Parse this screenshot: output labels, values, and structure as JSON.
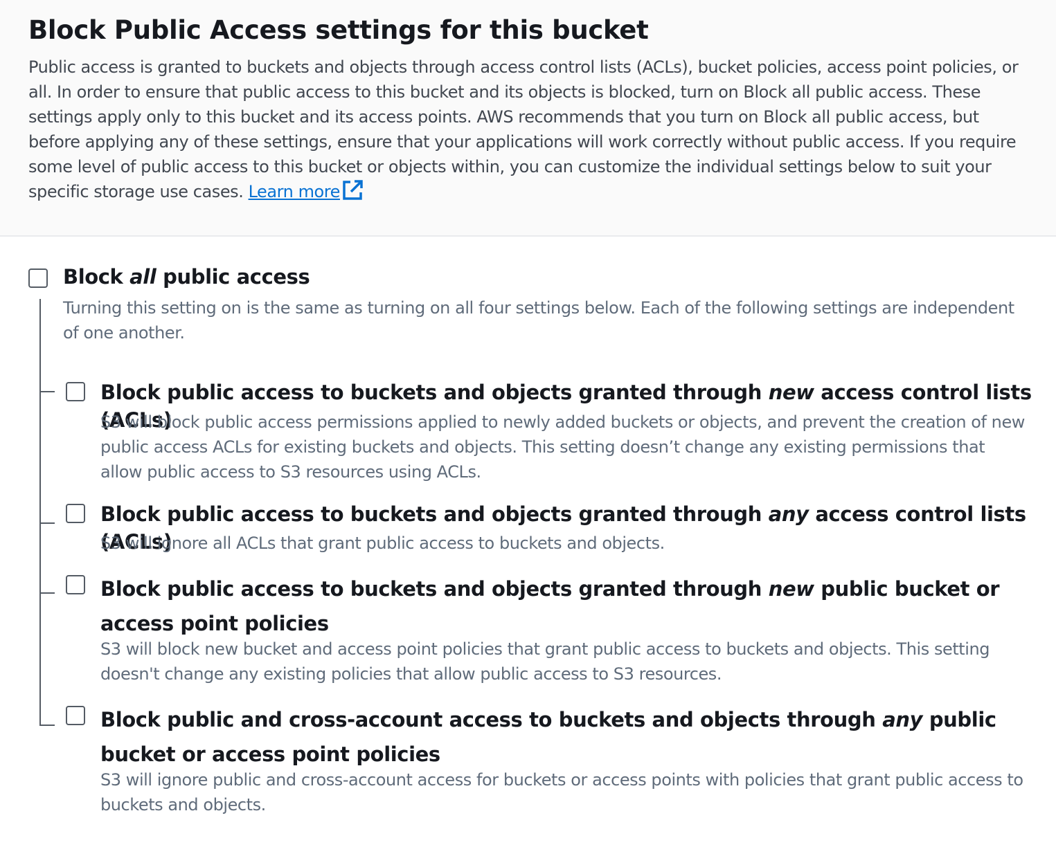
{
  "header": {
    "title": "Block Public Access settings for this bucket",
    "description": "Public access is granted to buckets and objects through access control lists (ACLs), bucket policies, access point policies, or all. In order to ensure that public access to this bucket and its objects is blocked, turn on Block all public access. These settings apply only to this bucket and its access points. AWS recommends that you turn on Block all public access, but before applying any of these settings, ensure that your applications will work correctly without public access. If you require some level of public access to this bucket or objects within, you can customize the individual settings below to suit your specific storage use cases.",
    "learn_more": "Learn more",
    "learn_more_icon": "external-link-icon",
    "link_color": "#0972d3"
  },
  "block_all": {
    "label_before": "Block ",
    "label_em": "all",
    "label_after": " public access",
    "description": "Turning this setting on is the same as turning on all four settings below. Each of the following settings are independent of one another.",
    "checked": false
  },
  "options": [
    {
      "label_before": "Block public access to buckets and objects granted through ",
      "label_em": "new",
      "label_after": " access control lists (ACLs)",
      "description": "S3 will block public access permissions applied to newly added buckets or objects, and prevent the creation of new public access ACLs for existing buckets and objects. This setting doesn’t change any existing permissions that allow public access to S3 resources using ACLs.",
      "checked": false
    },
    {
      "label_before": "Block public access to buckets and objects granted through ",
      "label_em": "any",
      "label_after": " access control lists (ACLs)",
      "description": "S3 will ignore all ACLs that grant public access to buckets and objects.",
      "checked": false
    },
    {
      "label_before": "Block public access to buckets and objects granted through ",
      "label_em": "new",
      "label_after": " public bucket or access point policies",
      "description": "S3 will block new bucket and access point policies that grant public access to buckets and objects. This setting doesn't change any existing policies that allow public access to S3 resources.",
      "checked": false
    },
    {
      "label_before": "Block public and cross-account access to buckets and objects through ",
      "label_em": "any",
      "label_after": " public bucket or access point policies",
      "description": "S3 will ignore public and cross-account access for buckets or access points with policies that grant public access to buckets and objects.",
      "checked": false
    }
  ]
}
